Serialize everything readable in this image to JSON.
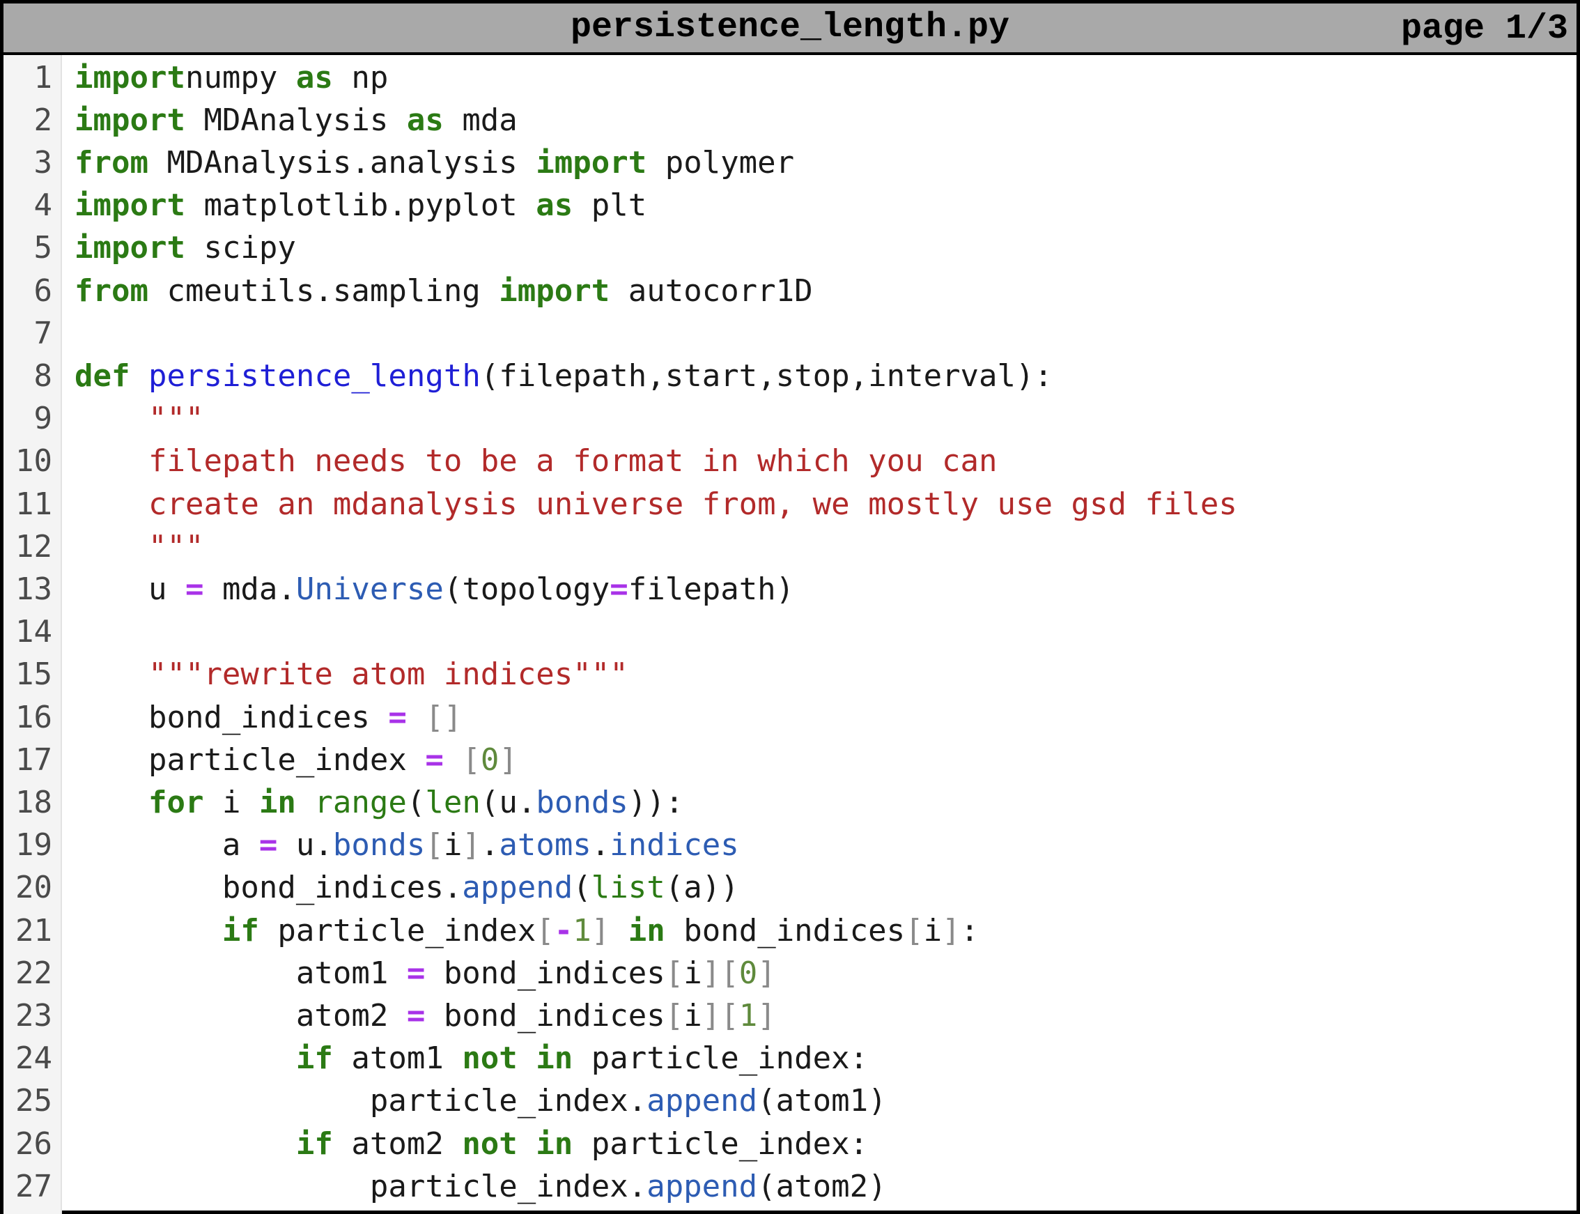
{
  "header": {
    "filename": "persistence_length.py",
    "page": "page 1/3"
  },
  "colors": {
    "keyword": "#2b7a14",
    "function_name": "#1f1fd6",
    "string": "#b22a2a",
    "operator": "#a832e8",
    "attribute": "#2d5cb3",
    "number": "#5f8a3c",
    "header_background": "#a9a9a9"
  },
  "lines": [
    {
      "n": "1",
      "tokens": [
        [
          "kw",
          "import"
        ],
        [
          "",
          "numpy "
        ],
        [
          "kw",
          "as"
        ],
        [
          "",
          " np"
        ]
      ]
    },
    {
      "n": "2",
      "tokens": [
        [
          "kw",
          "import"
        ],
        [
          "",
          " MDAnalysis "
        ],
        [
          "kw",
          "as"
        ],
        [
          "",
          " mda"
        ]
      ]
    },
    {
      "n": "3",
      "tokens": [
        [
          "kw",
          "from"
        ],
        [
          "",
          " MDAnalysis.analysis "
        ],
        [
          "kw",
          "import"
        ],
        [
          "",
          " polymer"
        ]
      ]
    },
    {
      "n": "4",
      "tokens": [
        [
          "kw",
          "import"
        ],
        [
          "",
          " matplotlib.pyplot "
        ],
        [
          "kw",
          "as"
        ],
        [
          "",
          " plt"
        ]
      ]
    },
    {
      "n": "5",
      "tokens": [
        [
          "kw",
          "import"
        ],
        [
          "",
          " scipy"
        ]
      ]
    },
    {
      "n": "6",
      "tokens": [
        [
          "kw",
          "from"
        ],
        [
          "",
          " cmeutils.sampling "
        ],
        [
          "kw",
          "import"
        ],
        [
          "",
          " autocorr1D"
        ]
      ]
    },
    {
      "n": "7",
      "tokens": []
    },
    {
      "n": "8",
      "tokens": [
        [
          "kw",
          "def"
        ],
        [
          "",
          " "
        ],
        [
          "fn",
          "persistence_length"
        ],
        [
          "",
          "(filepath,start,stop,interval):"
        ]
      ]
    },
    {
      "n": "9",
      "tokens": [
        [
          "",
          "    "
        ],
        [
          "st",
          "\"\"\""
        ]
      ]
    },
    {
      "n": "10",
      "tokens": [
        [
          "",
          "    "
        ],
        [
          "st",
          "filepath needs to be a format in which you can"
        ]
      ]
    },
    {
      "n": "11",
      "tokens": [
        [
          "",
          "    "
        ],
        [
          "st",
          "create an mdanalysis universe from, we mostly use gsd files"
        ]
      ]
    },
    {
      "n": "12",
      "tokens": [
        [
          "",
          "    "
        ],
        [
          "st",
          "\"\"\""
        ]
      ]
    },
    {
      "n": "13",
      "tokens": [
        [
          "",
          "    u "
        ],
        [
          "op",
          "="
        ],
        [
          "",
          " mda."
        ],
        [
          "at",
          "Universe"
        ],
        [
          "",
          "(topology"
        ],
        [
          "op",
          "="
        ],
        [
          "",
          "filepath)"
        ]
      ]
    },
    {
      "n": "14",
      "tokens": []
    },
    {
      "n": "15",
      "tokens": [
        [
          "",
          "    "
        ],
        [
          "st",
          "\"\"\"rewrite atom indices\"\"\""
        ]
      ]
    },
    {
      "n": "16",
      "tokens": [
        [
          "",
          "    bond_indices "
        ],
        [
          "op",
          "="
        ],
        [
          "",
          " "
        ],
        [
          "br",
          "[]"
        ]
      ]
    },
    {
      "n": "17",
      "tokens": [
        [
          "",
          "    particle_index "
        ],
        [
          "op",
          "="
        ],
        [
          "",
          " "
        ],
        [
          "br",
          "["
        ],
        [
          "nu",
          "0"
        ],
        [
          "br",
          "]"
        ]
      ]
    },
    {
      "n": "18",
      "tokens": [
        [
          "",
          "    "
        ],
        [
          "kw",
          "for"
        ],
        [
          "",
          " i "
        ],
        [
          "kw",
          "in"
        ],
        [
          "",
          " "
        ],
        [
          "bi",
          "range"
        ],
        [
          "",
          "("
        ],
        [
          "bi",
          "len"
        ],
        [
          "",
          "(u."
        ],
        [
          "at",
          "bonds"
        ],
        [
          "",
          "))"
        ],
        [
          "",
          ":"
        ]
      ]
    },
    {
      "n": "19",
      "tokens": [
        [
          "",
          "        a "
        ],
        [
          "op",
          "="
        ],
        [
          "",
          " u."
        ],
        [
          "at",
          "bonds"
        ],
        [
          "br",
          "["
        ],
        [
          "",
          "i"
        ],
        [
          "br",
          "]"
        ],
        [
          "",
          "."
        ],
        [
          "at",
          "atoms"
        ],
        [
          "",
          "."
        ],
        [
          "at",
          "indices"
        ]
      ]
    },
    {
      "n": "20",
      "tokens": [
        [
          "",
          "        bond_indices."
        ],
        [
          "at",
          "append"
        ],
        [
          "",
          "("
        ],
        [
          "bi",
          "list"
        ],
        [
          "",
          "(a))"
        ]
      ]
    },
    {
      "n": "21",
      "tokens": [
        [
          "",
          "        "
        ],
        [
          "kw",
          "if"
        ],
        [
          "",
          " particle_index"
        ],
        [
          "br",
          "["
        ],
        [
          "op",
          "-"
        ],
        [
          "nu",
          "1"
        ],
        [
          "br",
          "]"
        ],
        [
          "",
          " "
        ],
        [
          "kw",
          "in"
        ],
        [
          "",
          " bond_indices"
        ],
        [
          "br",
          "["
        ],
        [
          "",
          "i"
        ],
        [
          "br",
          "]"
        ],
        [
          "",
          ":"
        ]
      ]
    },
    {
      "n": "22",
      "tokens": [
        [
          "",
          "            atom1 "
        ],
        [
          "op",
          "="
        ],
        [
          "",
          " bond_indices"
        ],
        [
          "br",
          "["
        ],
        [
          "",
          "i"
        ],
        [
          "br",
          "]["
        ],
        [
          "nu",
          "0"
        ],
        [
          "br",
          "]"
        ]
      ]
    },
    {
      "n": "23",
      "tokens": [
        [
          "",
          "            atom2 "
        ],
        [
          "op",
          "="
        ],
        [
          "",
          " bond_indices"
        ],
        [
          "br",
          "["
        ],
        [
          "",
          "i"
        ],
        [
          "br",
          "]["
        ],
        [
          "nu",
          "1"
        ],
        [
          "br",
          "]"
        ]
      ]
    },
    {
      "n": "24",
      "tokens": [
        [
          "",
          "            "
        ],
        [
          "kw",
          "if"
        ],
        [
          "",
          " atom1 "
        ],
        [
          "kw",
          "not"
        ],
        [
          "",
          " "
        ],
        [
          "kw",
          "in"
        ],
        [
          "",
          " particle_index:"
        ]
      ]
    },
    {
      "n": "25",
      "tokens": [
        [
          "",
          "                particle_index."
        ],
        [
          "at",
          "append"
        ],
        [
          "",
          "(atom1)"
        ]
      ]
    },
    {
      "n": "26",
      "tokens": [
        [
          "",
          "            "
        ],
        [
          "kw",
          "if"
        ],
        [
          "",
          " atom2 "
        ],
        [
          "kw",
          "not"
        ],
        [
          "",
          " "
        ],
        [
          "kw",
          "in"
        ],
        [
          "",
          " particle_index:"
        ]
      ]
    },
    {
      "n": "27",
      "tokens": [
        [
          "",
          "                particle_index."
        ],
        [
          "at",
          "append"
        ],
        [
          "",
          "(atom2)"
        ]
      ]
    }
  ]
}
